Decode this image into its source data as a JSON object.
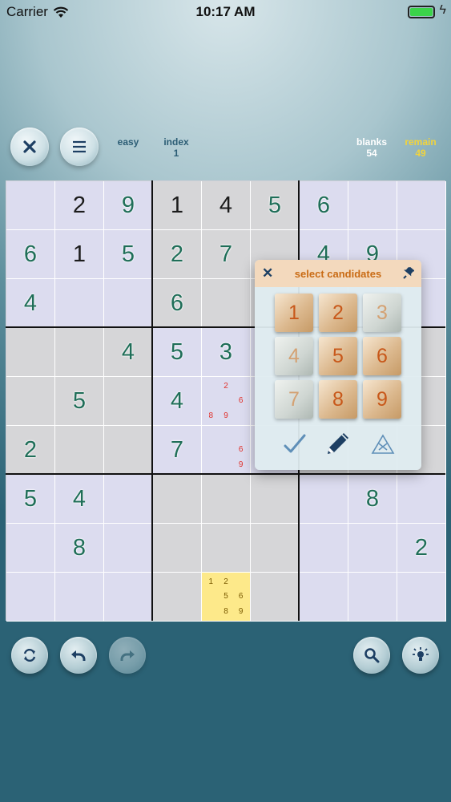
{
  "status_bar": {
    "carrier": "Carrier",
    "time": "10:17 AM"
  },
  "header": {
    "difficulty": "easy",
    "index_label": "index",
    "index_value": "1",
    "blanks_label": "blanks",
    "blanks_value": "54",
    "remain_label": "remain",
    "remain_value": "49",
    "remain_color": "#f2d43c"
  },
  "board": {
    "rows": [
      [
        "",
        "2",
        "9",
        "1",
        "4",
        "5",
        "6",
        "",
        ""
      ],
      [
        "6",
        "1",
        "5",
        "2",
        "7",
        "",
        "4",
        "9",
        ""
      ],
      [
        "4",
        "",
        "",
        "6",
        "",
        "",
        "",
        "",
        ""
      ],
      [
        "",
        "",
        "4",
        "5",
        "3",
        "",
        "",
        "",
        ""
      ],
      [
        "",
        "5",
        "",
        "4",
        "",
        "",
        "",
        "",
        ""
      ],
      [
        "2",
        "",
        "",
        "7",
        "",
        "",
        "",
        "",
        ""
      ],
      [
        "5",
        "4",
        "",
        "",
        "",
        "",
        "",
        "8",
        ""
      ],
      [
        "",
        "8",
        "",
        "",
        "",
        "",
        "",
        "",
        "2"
      ],
      [
        "",
        "",
        "",
        "",
        "",
        "",
        "",
        "",
        ""
      ]
    ],
    "given": [
      [
        0,
        1
      ],
      [
        0,
        3
      ],
      [
        0,
        4
      ],
      [
        1,
        1
      ]
    ],
    "candidates": {
      "4-4": [
        "",
        "2",
        "",
        "",
        "",
        "6",
        "8",
        "9",
        ""
      ],
      "5-4": [
        "",
        "",
        "",
        "",
        "",
        "6",
        "",
        "",
        "9"
      ],
      "8-4": [
        "1",
        "2",
        "",
        "",
        "5",
        "6",
        "",
        "8",
        "9"
      ]
    },
    "selected_cell": [
      8,
      4
    ],
    "selected_color": "#fde98a"
  },
  "popup": {
    "title": "select candidates",
    "close_icon": "close-icon",
    "pin_icon": "pin-icon",
    "keys": [
      {
        "label": "1",
        "state": "on"
      },
      {
        "label": "2",
        "state": "on"
      },
      {
        "label": "3",
        "state": "off"
      },
      {
        "label": "4",
        "state": "off"
      },
      {
        "label": "5",
        "state": "on"
      },
      {
        "label": "6",
        "state": "on"
      },
      {
        "label": "7",
        "state": "off"
      },
      {
        "label": "8",
        "state": "on"
      },
      {
        "label": "9",
        "state": "on"
      }
    ],
    "tools": [
      "check-icon",
      "pencil-icon",
      "clear-icon"
    ]
  },
  "bottom_bar": {
    "buttons": [
      "restart-icon",
      "undo-icon",
      "redo-icon",
      "search-icon",
      "hint-icon"
    ]
  }
}
